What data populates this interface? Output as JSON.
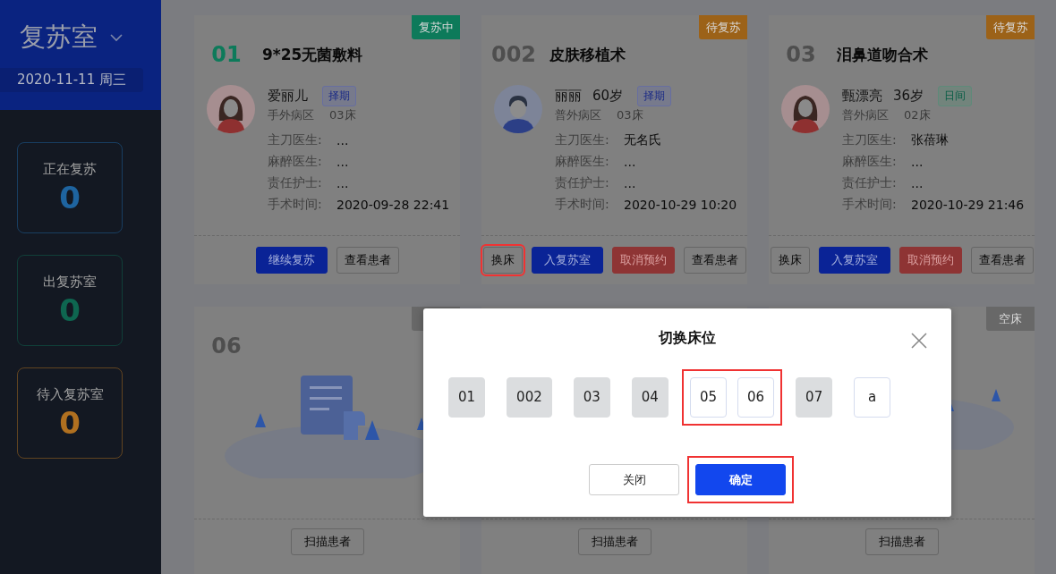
{
  "sidebar": {
    "title": "复苏室",
    "date": "2020-11-11 周三",
    "stats": [
      {
        "label": "正在复苏",
        "value": "0",
        "color": "#1e64a0"
      },
      {
        "label": "出复苏室",
        "value": "0",
        "color": "#0e6650"
      },
      {
        "label": "待入复苏室",
        "value": "0",
        "color": "#b07020"
      }
    ]
  },
  "cards": [
    {
      "kind": "recovering",
      "number": "01",
      "status": {
        "text": "复苏中",
        "color": "#0d7a5a"
      },
      "title": "9*25无菌敷料",
      "avatar": {
        "kind": "female"
      },
      "name": "爱丽儿",
      "tag": {
        "text": "择期",
        "kind": "elective"
      },
      "ward": "手外病区",
      "bed": "03床",
      "info": [
        {
          "label": "主刀医生:",
          "value": "..."
        },
        {
          "label": "麻醉医生:",
          "value": "..."
        },
        {
          "label": "责任护士:",
          "value": "..."
        },
        {
          "label": "手术时间:",
          "value": "2020-09-28 22:41"
        }
      ],
      "buttons": [
        {
          "text": "继续复苏",
          "kind": "primary",
          "highlighted": false
        },
        {
          "text": "查看患者",
          "kind": "default",
          "highlighted": false
        }
      ]
    },
    {
      "kind": "waiting",
      "number": "002",
      "status": {
        "text": "待复苏",
        "color": "#9c6218"
      },
      "title": "皮肤移植术",
      "avatar": {
        "kind": "male"
      },
      "name": "丽丽",
      "age": "60岁",
      "tag": {
        "text": "择期",
        "kind": "elective"
      },
      "ward": "普外病区",
      "bed": "03床",
      "info": [
        {
          "label": "主刀医生:",
          "value": "无名氏"
        },
        {
          "label": "麻醉医生:",
          "value": "..."
        },
        {
          "label": "责任护士:",
          "value": "..."
        },
        {
          "label": "手术时间:",
          "value": "2020-10-29 10:20"
        }
      ],
      "buttons": [
        {
          "text": "换床",
          "kind": "default",
          "highlighted": true
        },
        {
          "text": "入复苏室",
          "kind": "primary",
          "highlighted": false
        },
        {
          "text": "取消预约",
          "kind": "danger",
          "highlighted": false
        },
        {
          "text": "查看患者",
          "kind": "default",
          "highlighted": false
        }
      ]
    },
    {
      "kind": "waiting",
      "number": "03",
      "status": {
        "text": "待复苏",
        "color": "#9c6218"
      },
      "title": "泪鼻道吻合术",
      "avatar": {
        "kind": "female"
      },
      "name": "甄漂亮",
      "age": "36岁",
      "tag": {
        "text": "日间",
        "kind": "day"
      },
      "ward": "普外病区",
      "bed": "02床",
      "info": [
        {
          "label": "主刀医生:",
          "value": "张蓓琳"
        },
        {
          "label": "麻醉医生:",
          "value": "..."
        },
        {
          "label": "责任护士:",
          "value": "..."
        },
        {
          "label": "手术时间:",
          "value": "2020-10-29 21:46"
        }
      ],
      "buttons": [
        {
          "text": "换床",
          "kind": "default",
          "highlighted": false
        },
        {
          "text": "入复苏室",
          "kind": "primary",
          "highlighted": false
        },
        {
          "text": "取消预约",
          "kind": "danger",
          "highlighted": false
        },
        {
          "text": "查看患者",
          "kind": "default",
          "highlighted": false
        }
      ]
    },
    {
      "kind": "empty",
      "number": "06",
      "status": {
        "color": "#686868"
      },
      "buttons": [
        {
          "text": "扫描患者",
          "kind": "default",
          "highlighted": false
        }
      ]
    },
    {
      "buttons": [
        {
          "text": "扫描患者",
          "kind": "default",
          "highlighted": false
        }
      ]
    },
    {
      "kind": "empty",
      "status": {
        "text": "空床",
        "color": "#686868"
      },
      "buttons": [
        {
          "text": "扫描患者",
          "kind": "default",
          "highlighted": false
        }
      ]
    }
  ],
  "dialog": {
    "title": "切换床位",
    "beds": [
      {
        "label": "01",
        "occupied": true,
        "highlighted": false
      },
      {
        "label": "002",
        "occupied": true,
        "highlighted": false
      },
      {
        "label": "03",
        "occupied": true,
        "highlighted": false
      },
      {
        "label": "04",
        "occupied": true,
        "highlighted": false
      },
      {
        "label": "05",
        "occupied": false,
        "highlighted": true
      },
      {
        "label": "06",
        "occupied": false,
        "highlighted": true
      },
      {
        "label": "07",
        "occupied": true,
        "highlighted": false
      },
      {
        "label": "a",
        "occupied": false,
        "highlighted": false
      }
    ],
    "buttons": [
      {
        "text": "关闭",
        "kind": "default",
        "highlighted": false
      },
      {
        "text": "确定",
        "kind": "primary",
        "highlighted": true
      }
    ]
  }
}
